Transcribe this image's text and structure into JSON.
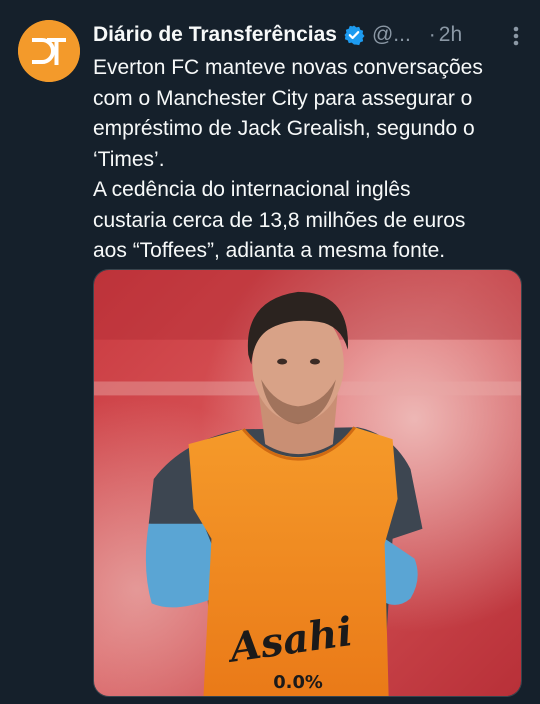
{
  "tweet": {
    "author": {
      "display_name": "Diário de Transferências",
      "handle": "@...",
      "verified": true,
      "avatar_text": "DT",
      "avatar_color": "#f39a2b"
    },
    "timestamp_separator": "·",
    "timestamp": "2h",
    "text_lines": [
      "Everton FC manteve novas conversações",
      "com o Manchester City para assegurar o",
      "empréstimo de Jack Grealish, segundo o",
      "‘Times’.",
      "A cedência do internacional inglês",
      "custaria cerca de 13,8 milhões de euros",
      "aos “Toffees”, adianta a mesma fonte."
    ],
    "media": {
      "sponsor_text": "Asahi",
      "sponsor_subtext": "0.0%"
    },
    "icons": {
      "verified": "verified-badge-icon",
      "more": "more-options-icon"
    },
    "colors": {
      "background": "#15202b",
      "text": "#f7f9f9",
      "secondary": "#8b98a5",
      "verified": "#1d9bf0",
      "bib": "#f0861f"
    }
  }
}
